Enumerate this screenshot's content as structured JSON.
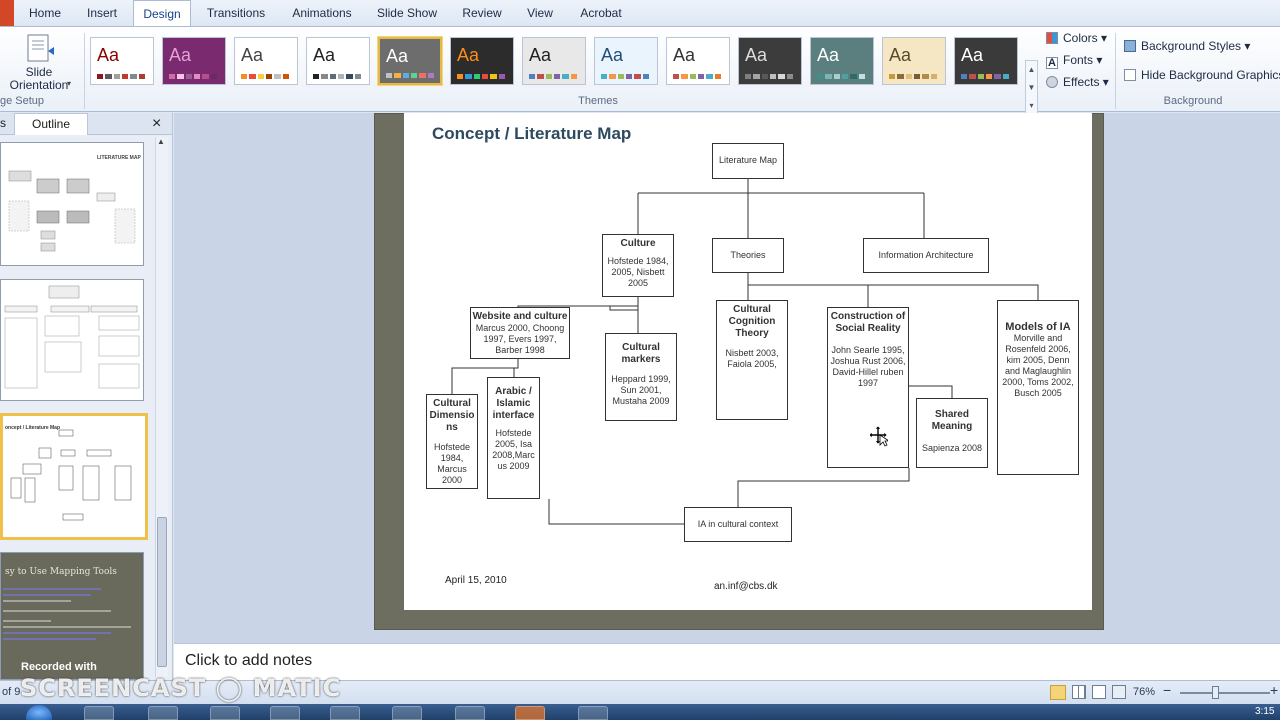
{
  "tabs": [
    "Home",
    "Insert",
    "Design",
    "Transitions",
    "Animations",
    "Slide Show",
    "Review",
    "View",
    "Acrobat"
  ],
  "ribbon": {
    "slide_orientation": "Slide Orientation",
    "page_setup_label": "ge Setup",
    "themes_label": "Themes",
    "colors": "Colors",
    "fonts": "Fonts",
    "effects": "Effects",
    "background_styles": "Background Styles",
    "hide_background": "Hide Background Graphics",
    "background_label": "Background",
    "theme_glyph": "Aa"
  },
  "themes": [
    {
      "bg": "#ffffff",
      "fg": "#8b0000",
      "bars": [
        "#8b1a1a",
        "#5a5a5a",
        "#a0a0a0",
        "#c0392b",
        "#7f8c8d",
        "#b03a2e"
      ]
    },
    {
      "bg": "#7a2a6e",
      "fg": "#e6a0d8",
      "bars": [
        "#d06aa8",
        "#f7c6e6",
        "#9c5d92",
        "#e28cc0",
        "#b34f8f",
        "#6b2a62"
      ]
    },
    {
      "bg": "#ffffff",
      "fg": "#444444",
      "bars": [
        "#f28c28",
        "#e74c3c",
        "#f4d03f",
        "#a04000",
        "#c0c0c0",
        "#d35400"
      ]
    },
    {
      "bg": "#ffffff",
      "fg": "#222222",
      "bars": [
        "#222222",
        "#888888",
        "#5d6d7e",
        "#aab7b8",
        "#34495e",
        "#7f8c8d"
      ]
    },
    {
      "bg": "#6d6d6d",
      "fg": "#ffffff",
      "bars": [
        "#c0c0c0",
        "#f5b041",
        "#5dade2",
        "#58d68d",
        "#ec7063",
        "#af7ac5"
      ]
    },
    {
      "bg": "#2c2c2c",
      "fg": "#ff8c1a",
      "bars": [
        "#ff8c1a",
        "#3498db",
        "#2ecc71",
        "#e74c3c",
        "#f1c40f",
        "#9b59b6"
      ]
    },
    {
      "bg": "#e8e8e8",
      "fg": "#222222",
      "bars": [
        "#4f81bd",
        "#c0504d",
        "#9bbb59",
        "#8064a2",
        "#4bacc6",
        "#f79646"
      ]
    },
    {
      "bg": "#eaf4fc",
      "fg": "#1f4e79",
      "bars": [
        "#4bacc6",
        "#f79646",
        "#9bbb59",
        "#8064a2",
        "#c0504d",
        "#4f81bd"
      ]
    },
    {
      "bg": "#ffffff",
      "fg": "#333333",
      "bars": [
        "#c0504d",
        "#f79646",
        "#9bbb59",
        "#8064a2",
        "#4bacc6",
        "#e67e22"
      ]
    },
    {
      "bg": "#3c3c3c",
      "fg": "#dddddd",
      "bars": [
        "#7f7f7f",
        "#a5a5a5",
        "#595959",
        "#bfbfbf",
        "#d9d9d9",
        "#8c8c8c"
      ]
    },
    {
      "bg": "#5b7f7f",
      "fg": "#ffffff",
      "bars": [
        "#3f8f8f",
        "#7fb3b3",
        "#a3d1d1",
        "#4fa0a0",
        "#2e6b6b",
        "#c2e0e0"
      ]
    },
    {
      "bg": "#f5e6c4",
      "fg": "#5a4a2a",
      "bars": [
        "#c49a3b",
        "#8a6d3b",
        "#e0c07a",
        "#7a5c2e",
        "#b5894a",
        "#d4b070"
      ]
    },
    {
      "bg": "#3a3a3a",
      "fg": "#ffffff",
      "bars": [
        "#4f81bd",
        "#c0504d",
        "#9bbb59",
        "#f79646",
        "#8064a2",
        "#4bacc6"
      ]
    }
  ],
  "left_pane": {
    "outline_tab": "Outline",
    "slides_tab": "s",
    "close": "×",
    "thumb1_title": "LITERATURE MAP",
    "thumb3_title": "oncept / Literature Map",
    "thumb4_title": "sy to Use Mapping Tools",
    "recorded": "Recorded with"
  },
  "slide": {
    "title": "Concept / Literature Map",
    "date": "April 15, 2010",
    "email": "an.inf@cbs.dk",
    "boxes": {
      "lit_map": "Literature Map",
      "culture_title": "Culture",
      "culture_body": "Hofstede 1984, 2005, Nisbett 2005",
      "theories": "Theories",
      "info_arch": "Information Architecture",
      "website_title": "Website and culture",
      "website_body": "Marcus 2000, Choong 1997, Evers 1997, Barber 1998",
      "cult_markers_title": "Cultural markers",
      "cult_markers_body": "Heppard 1999, Sun 2001, Mustaha 2009",
      "cog_title": "Cultural Cognition Theory",
      "cog_body": "Nisbett 2003, Faiola 2005,",
      "social_title": "Construction of Social Reality",
      "social_body": "John Searle 1995, Joshua Rust 2006, David-Hillel ruben 1997",
      "models_title": "Models of IA",
      "models_body": "Morville and Rosenfeld 2006, kim 2005, Denn and Maglaughlin 2000, Toms 2002, Busch 2005",
      "dims_title": "Cultural Dimensio ns",
      "dims_body": "Hofstede 1984, Marcus 2000",
      "arabic_title": "Arabic / Islamic interface",
      "arabic_body": "Hofstede 2005, Isa 2008,Marc us 2009",
      "shared_title": "Shared Meaning",
      "shared_body": "Sapienza 2008",
      "ia_context": "IA in cultural context"
    }
  },
  "notes_placeholder": "Click to add notes",
  "status": {
    "slide_count": "of 9",
    "zoom": "76%",
    "zoom_out": "−",
    "zoom_in": "+",
    "time": "3:15"
  },
  "watermark": "SCREENCAST ◯ MATIC"
}
